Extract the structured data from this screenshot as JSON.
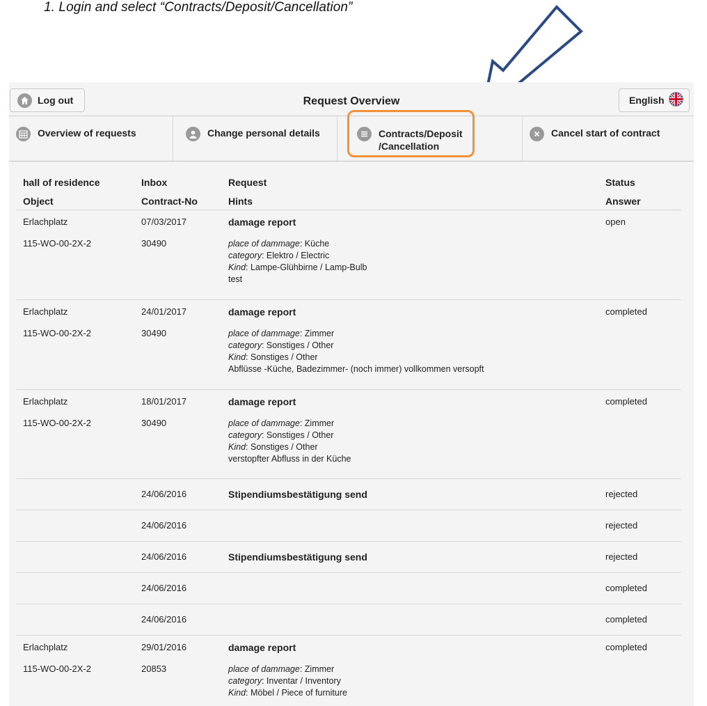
{
  "instruction": "1. Login and select “Contracts/Deposit/Cancellation”",
  "header": {
    "logout_label": "Log out",
    "title": "Request Overview",
    "language_label": "English"
  },
  "tabs": [
    {
      "label": "Overview of requests"
    },
    {
      "label": "Change personal details"
    },
    {
      "label": "Contracts/Deposit",
      "label2": "/Cancellation"
    },
    {
      "label": "Cancel start of contract"
    }
  ],
  "table": {
    "head1": [
      "hall of residence",
      "Inbox",
      "Request",
      "Status"
    ],
    "head2": [
      "Object",
      "Contract-No",
      "Hints",
      "Answer"
    ],
    "rows": [
      {
        "hall": "Erlachplatz",
        "object": "115-WO-00-2X-2",
        "inbox": "07/03/2017",
        "contract": "30490",
        "request": "damage report",
        "status": "open",
        "place_label": "place of dammage",
        "place": ": Küche",
        "category_label": "category",
        "category": ": Elektro / Electric",
        "kind_label": "Kind",
        "kind": ": Lampe-Glühbirne / Lamp-Bulb",
        "note": "test"
      },
      {
        "hall": "Erlachplatz",
        "object": "115-WO-00-2X-2",
        "inbox": "24/01/2017",
        "contract": "30490",
        "request": "damage report",
        "status": "completed",
        "place_label": "place of dammage",
        "place": ": Zimmer",
        "category_label": "category",
        "category": ": Sonstiges / Other",
        "kind_label": "Kind",
        "kind": ": Sonstiges / Other",
        "note": "Abflüsse -Küche, Badezimmer- (noch immer) vollkommen versopft"
      },
      {
        "hall": "Erlachplatz",
        "object": "115-WO-00-2X-2",
        "inbox": "18/01/2017",
        "contract": "30490",
        "request": "damage report",
        "status": "completed",
        "place_label": "place of dammage",
        "place": ": Zimmer",
        "category_label": "category",
        "category": ": Sonstiges / Other",
        "kind_label": "Kind",
        "kind": ": Sonstiges / Other",
        "note": "verstopfter Abfluss in der Küche"
      },
      {
        "inbox": "24/06/2016",
        "request": "Stipendiumsbestätigung send",
        "status": "rejected"
      },
      {
        "inbox": "24/06/2016",
        "request": "",
        "status": "rejected"
      },
      {
        "inbox": "24/06/2016",
        "request": "Stipendiumsbestätigung send",
        "status": "rejected"
      },
      {
        "inbox": "24/06/2016",
        "request": "",
        "status": "completed"
      },
      {
        "inbox": "24/06/2016",
        "request": "",
        "status": "completed"
      },
      {
        "hall": "Erlachplatz",
        "object": "115-WO-00-2X-2",
        "inbox": "29/01/2016",
        "contract": "20853",
        "request": "damage report",
        "status": "completed",
        "place_label": "place of dammage",
        "place": ": Zimmer",
        "category_label": "category",
        "category": ": Inventar / Inventory",
        "kind_label": "Kind",
        "kind": ": Möbel / Piece of furniture"
      }
    ]
  },
  "colors": {
    "highlight": "#f0923c",
    "arrow": "#2a4a86"
  },
  "icons": {
    "logout": "home-icon",
    "language": "uk-flag-icon",
    "tab1": "calendar-icon",
    "tab2": "person-icon",
    "tab3": "list-icon",
    "tab4": "close-circle-icon"
  }
}
